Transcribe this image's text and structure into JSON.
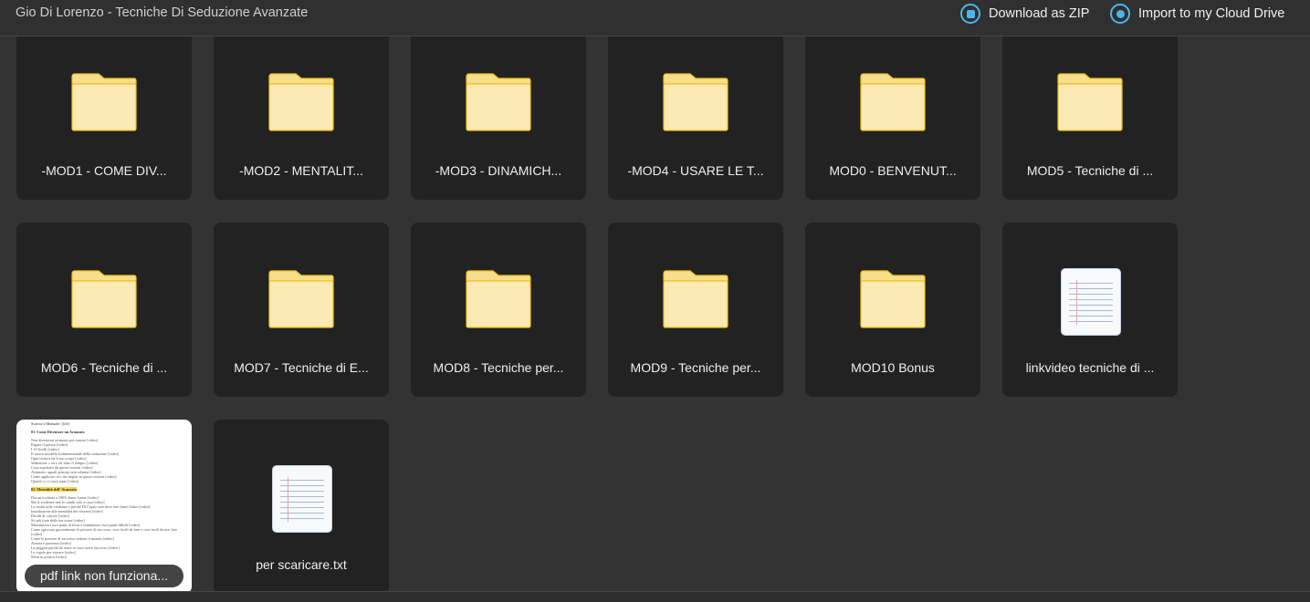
{
  "header": {
    "title": "Gio Di Lorenzo - Tecniche Di Seduzione Avanzate",
    "download_zip": "Download as ZIP",
    "import_cloud": "Import to my Cloud Drive",
    "accent": "#4fb4ec"
  },
  "items": [
    {
      "label": "-MOD1 - COME DIV...",
      "type": "folder"
    },
    {
      "label": "-MOD2 - MENTALIT...",
      "type": "folder"
    },
    {
      "label": "-MOD3 - DINAMICH...",
      "type": "folder"
    },
    {
      "label": "-MOD4 - USARE LE T...",
      "type": "folder"
    },
    {
      "label": "MOD0 - BENVENUT...",
      "type": "folder"
    },
    {
      "label": "MOD5 - Tecniche di ...",
      "type": "folder"
    },
    {
      "label": "MOD6 - Tecniche di ...",
      "type": "folder"
    },
    {
      "label": "MOD7 - Tecniche di E...",
      "type": "folder"
    },
    {
      "label": "MOD8 - Tecniche per...",
      "type": "folder"
    },
    {
      "label": "MOD9 - Tecniche per...",
      "type": "folder"
    },
    {
      "label": "MOD10 Bonus",
      "type": "folder"
    },
    {
      "label": "linkvideo tecniche di ...",
      "type": "text-file"
    },
    {
      "label": "pdf link non funziona...",
      "type": "pdf-thumbnail"
    },
    {
      "label": "per scaricare.txt",
      "type": "text-file"
    }
  ],
  "pdf_preview": {
    "first_line": "Scarica il Manuale: [file]",
    "heading1": "01. Come Diventare un Avanzato",
    "lines1": [
      "Non diventerai avanzato per osmosi [video]",
      "Pagare il prezzo [video]",
      "I 10 livelli [video]",
      "Il nuovo modello tridimensionale della seduzione [video]",
      "Ogni tecnica ha il suo scopo [video]",
      "Seduzione « on e off tutto il tempo» [video]",
      "Cosa aspettarti da queste sezioni [video]",
      "Avanzato: uguali principi non schema [video]",
      "Come applicare ciò che impari in queste sezioni [video]",
      "Quindi ci ci vorrà tanto [video]"
    ],
    "heading2": "02. Mentalità dell' Avanzato",
    "lines2": [
      "Dai un'occhiata a 100% Inner Game [video]",
      "Ma le credenze non le cambi solo a casa [video]",
      "La realtà sulle credenze e perché Di Caprio non deve fare Inner Game [video]",
      "Introduzione alle mentalità dei vincenti [video]",
      "Decidi di vincere [video]",
      "Sii più forte delle tue scuse [video]",
      "Massimizza i tuoi punti di forza e minimizza i tuoi punti deboli [video]",
      "Come agiscono giornalmente le persone di successo: cose facili da fare e cose facili da non fare [video]",
      "Come le persone di successo vedono il mondo [video]",
      "Azione e pazienza [video]",
      "La peggior parola da usare se vuoi avere successo [video]",
      "Le regole per vincere [video]",
      "Metti in pratica [video]"
    ]
  }
}
